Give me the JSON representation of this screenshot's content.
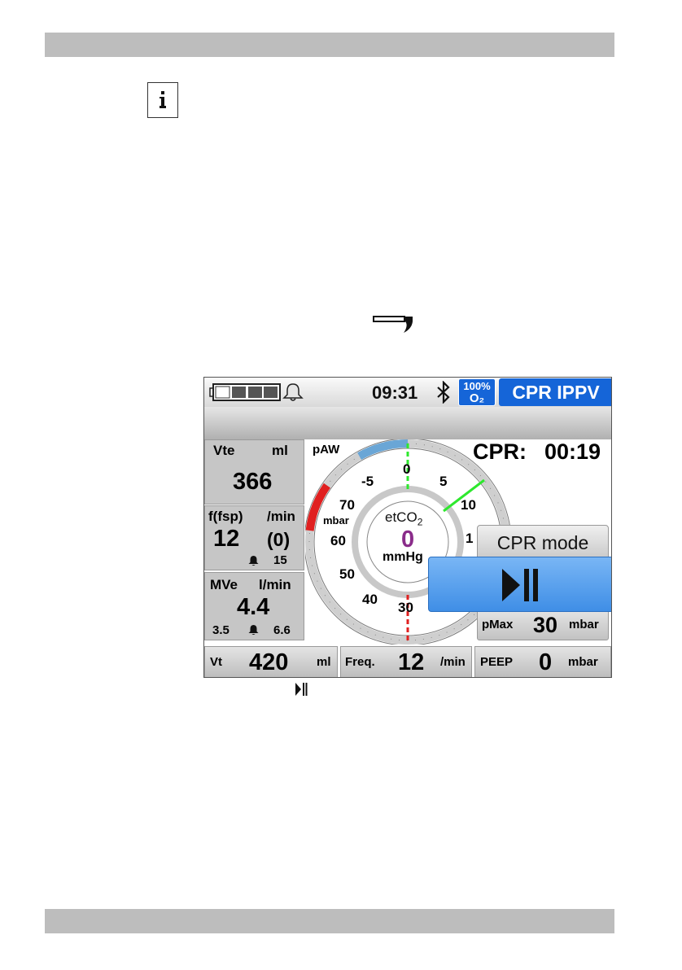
{
  "page": {
    "info_icon": "info-icon",
    "wrench_icon": "wrench-icon",
    "caption_icon": "play-pause-icon"
  },
  "device": {
    "status": {
      "battery_icon": "battery-icon",
      "bell_icon": "bell-icon",
      "time": "09:31",
      "bluetooth_icon": "bluetooth-icon",
      "o2_line1": "100%",
      "o2_line2": "O₂",
      "mode": "CPR IPPV"
    },
    "vte": {
      "label": "Vte",
      "unit": "ml",
      "value": "366"
    },
    "fsp": {
      "label": "f(fsp)",
      "unit": "/min",
      "value": "12",
      "value2": "(0)",
      "alarm_high": "15"
    },
    "mve": {
      "label": "MVe",
      "unit": "l/min",
      "value": "4.4",
      "alarm_low": "3.5",
      "alarm_high": "6.6"
    },
    "gauge": {
      "label": "pAW",
      "unit": "mbar",
      "ticks": [
        "-5",
        "0",
        "5",
        "10",
        "1",
        "70",
        "60",
        "50",
        "40",
        "30"
      ],
      "center_label": "etCO",
      "center_sub": "2",
      "center_value": "0",
      "center_unit": "mmHg"
    },
    "cpr_timer": {
      "label": "CPR:",
      "value": "00:19"
    },
    "cpr_mode_button": "CPR mode",
    "pmax": {
      "label": "pMax",
      "value": "30",
      "unit": "mbar"
    },
    "bottom": [
      {
        "label": "Vt",
        "value": "420",
        "unit": "ml"
      },
      {
        "label": "Freq.",
        "value": "12",
        "unit": "/min"
      },
      {
        "label": "PEEP",
        "value": "0",
        "unit": "mbar"
      }
    ],
    "colors": {
      "mode_blue": "#1565d8",
      "overlay_blue": "#5aa2ee",
      "gauge_red": "#e02020",
      "gauge_green": "#2ee82e",
      "gauge_blue": "#6aa6d6",
      "etco2_purple": "#8a2c8a"
    }
  }
}
